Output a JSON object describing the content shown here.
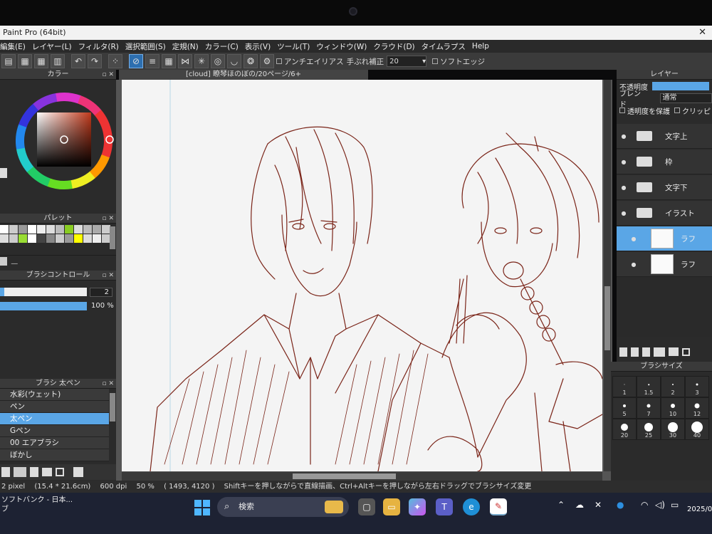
{
  "window": {
    "title": "Paint Pro (64bit)"
  },
  "menu": [
    "編集(E)",
    "レイヤー(L)",
    "フィルタ(R)",
    "選択範囲(S)",
    "定規(N)",
    "カラー(C)",
    "表示(V)",
    "ツール(T)",
    "ウィンドウ(W)",
    "クラウド(D)",
    "タイムラプス",
    "Help"
  ],
  "toolbar": {
    "antialias_label": "アンチエイリアス",
    "stabilizer_label": "手ぶれ補正",
    "stabilizer_value": "20",
    "soft_edge_label": "ソフトエッジ"
  },
  "document": {
    "tab_title": "[cloud] 瞭琴ほのぼの/20ページ/6+"
  },
  "color_panel": {
    "title": "カラー"
  },
  "palette_panel": {
    "title": "パレット",
    "swatches": [
      "#ffffff",
      "#cccccc",
      "#999999",
      "#ffffff",
      "#eeeeee",
      "#dddddd",
      "#bbbbbb",
      "#88cc22",
      "#dddddd",
      "#bbbbbb",
      "#aaaaaa",
      "#cccccc",
      "#dddddd",
      "#cccccc",
      "#99dd33",
      "#ffffff",
      "#444444",
      "#888888",
      "#cccccc",
      "#999999",
      "#ffff00",
      "#dddddd",
      "#eeeeee",
      "#cccccc"
    ]
  },
  "brush_control": {
    "title": "ブラシコントロール",
    "size_value": "2",
    "opacity_value": "100 %",
    "size_fill": 0.05,
    "opacity_fill": 1.0
  },
  "brush_list": {
    "title": "ブラシ 太ペン",
    "items": [
      {
        "label": "水彩(ウェット)",
        "active": false
      },
      {
        "label": "ペン",
        "active": false
      },
      {
        "label": "太ペン",
        "active": true
      },
      {
        "label": "Gペン",
        "active": false
      },
      {
        "label": "00 エアブラシ",
        "active": false
      },
      {
        "label": "ぼかし",
        "active": false
      }
    ]
  },
  "layer_panel": {
    "title": "レイヤー",
    "opacity_label": "不透明度",
    "blend_label": "ブレンド",
    "blend_value": "通常",
    "protect_label": "透明度を保護",
    "clipping_label": "クリッピ",
    "layers": [
      {
        "name": "文字上",
        "type": "folder",
        "selected": false
      },
      {
        "name": "枠",
        "type": "folder",
        "selected": false
      },
      {
        "name": "文字下",
        "type": "folder",
        "selected": false
      },
      {
        "name": "イラスト",
        "type": "folder",
        "selected": false
      },
      {
        "name": "ラフ",
        "type": "layer",
        "selected": true
      },
      {
        "name": "ラフ",
        "type": "layer",
        "selected": false
      }
    ]
  },
  "brush_size_panel": {
    "title": "ブラシサイズ",
    "sizes": [
      "1",
      "1.5",
      "2",
      "3",
      "5",
      "7",
      "10",
      "12",
      "20",
      "25",
      "30",
      "40"
    ]
  },
  "status": {
    "pixel": "2 pixel",
    "size": "(15.4 * 21.6cm)",
    "dpi": "600 dpi",
    "zoom": "50 %",
    "coords": "( 1493, 4120 )",
    "hint": "Shiftキーを押しながらで直線描画、Ctrl+Altキーを押しながら左右ドラッグでブラシサイズ変更"
  },
  "taskbar": {
    "app_line1": "ソフトバンク - 日本...",
    "app_line2": "ブ",
    "search_placeholder": "検索",
    "date": "2025/0"
  }
}
